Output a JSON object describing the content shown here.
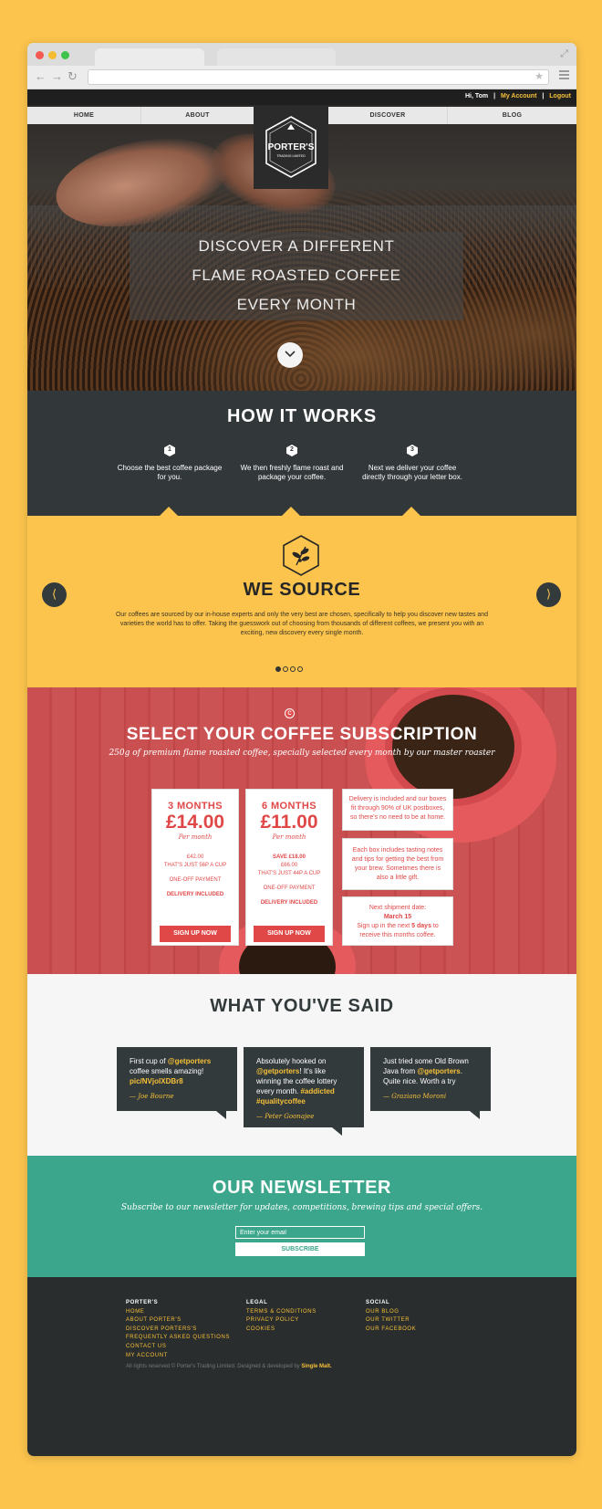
{
  "topbar": {
    "greeting": "Hi, Tom",
    "separator": "|",
    "my_account": "My Account",
    "logout": "Logout"
  },
  "nav": {
    "items": [
      "HOME",
      "ABOUT",
      "DISCOVER",
      "BLOG"
    ],
    "logo_line1": "PORTER'S",
    "logo_line2": "TRADING LIMITED"
  },
  "hero": {
    "line1": "DISCOVER A DIFFERENT",
    "line2": "FLAME ROASTED COFFEE",
    "line3": "EVERY MONTH",
    "scroll_icon": "chevron-down-icon"
  },
  "how": {
    "title": "HOW IT WORKS",
    "steps": [
      {
        "num": "1",
        "text": "Choose the best coffee package for you."
      },
      {
        "num": "2",
        "text": "We then freshly flame roast and package your coffee."
      },
      {
        "num": "3",
        "text": "Next we deliver your coffee directly through your letter box."
      }
    ]
  },
  "source": {
    "title": "WE SOURCE",
    "body": "Our coffees are sourced by our in-house experts and only the very best are chosen, specifically to help you discover new tastes and varieties the world has to offer. Taking the guesswork out of choosing from thousands of different coffees, we present you with an exciting, new discovery every single month.",
    "prev": "⟨",
    "next": "⟩",
    "active_slide": 1,
    "slide_count": 4
  },
  "subscription": {
    "icon_letter": "C",
    "title": "SELECT YOUR COFFEE SUBSCRIPTION",
    "tagline": "250g of premium flame roasted coffee, specially selected every month by our master roaster",
    "plans": [
      {
        "term": "3 MONTHS",
        "price": "£14.00",
        "per": "Per month",
        "save": "",
        "total": "£42.00",
        "per_cup": "THAT'S JUST 56P A CUP",
        "payment": "ONE-OFF PAYMENT",
        "delivery": "DELIVERY INCLUDED",
        "cta": "SIGN UP NOW"
      },
      {
        "term": "6 MONTHS",
        "price": "£11.00",
        "per": "Per month",
        "save": "SAVE £18.00",
        "total": "£66.00",
        "per_cup": "THAT'S JUST 44P A CUP",
        "payment": "ONE-OFF PAYMENT",
        "delivery": "DELIVERY INCLUDED",
        "cta": "SIGN UP NOW"
      }
    ],
    "info1": "Delivery is included and our boxes fit through 90% of UK postboxes, so there's no need to be at home.",
    "info2": "Each box includes tasting notes and tips for getting the best from your brew. Sometimes there is also a little gift.",
    "info3_label": "Next shipment date:",
    "info3_date": "March 15",
    "info3_pre": "Sign up in the next ",
    "info3_days": "5 days",
    "info3_post": " to receive this months coffee."
  },
  "said": {
    "title": "WHAT YOU'VE SAID",
    "tweets": [
      {
        "pre": "First cup of ",
        "handle": "@getporters",
        "mid": " coffee smells amazing! ",
        "link": "pic/NVjoIXDBr8",
        "post": "",
        "author": "— Joe Bourne"
      },
      {
        "pre": "Absolutely hooked on ",
        "handle": "@getporters",
        "mid": "! It's like winning the coffee lottery every month. ",
        "link": "#addicted #qualitycoffee",
        "post": "",
        "author": "— Peter Goonajee"
      },
      {
        "pre": "Just tried some Old Brown Java from ",
        "handle": "@getporters",
        "mid": ". Quite nice. Worth a try",
        "link": "",
        "post": "",
        "author": "— Graziano Moroni"
      }
    ]
  },
  "newsletter": {
    "title": "OUR NEWSLETTER",
    "tagline": "Subscribe to our newsletter for updates, competitions, brewing tips and special offers.",
    "email_placeholder": "Enter your email",
    "button": "SUBSCRIBE"
  },
  "footer": {
    "col1": {
      "heading": "PORTER'S",
      "links": [
        "HOME",
        "ABOUT PORTER'S",
        "DISCOVER PORTERS'S",
        "FREQUENTLY ASKED QUESTIONS",
        "CONTACT US",
        "MY ACCOUNT"
      ]
    },
    "col2": {
      "heading": "LEGAL",
      "links": [
        "TERMS & CONDITIONS",
        "PRIVACY POLICY",
        "COOKIES"
      ]
    },
    "col3": {
      "heading": "SOCIAL",
      "links": [
        "OUR BLOG",
        "OUR TWITTER",
        "OUR FACEBOOK"
      ]
    },
    "copyright": "All rights reserved © Porter's Trading Limited. Designed & developed by ",
    "developer": "Single Malt."
  },
  "colors": {
    "page_bg": "#fcc44d",
    "dark": "#323739",
    "red": "#e04848",
    "green": "#3ba68b",
    "yellow_text": "#f5c038"
  }
}
